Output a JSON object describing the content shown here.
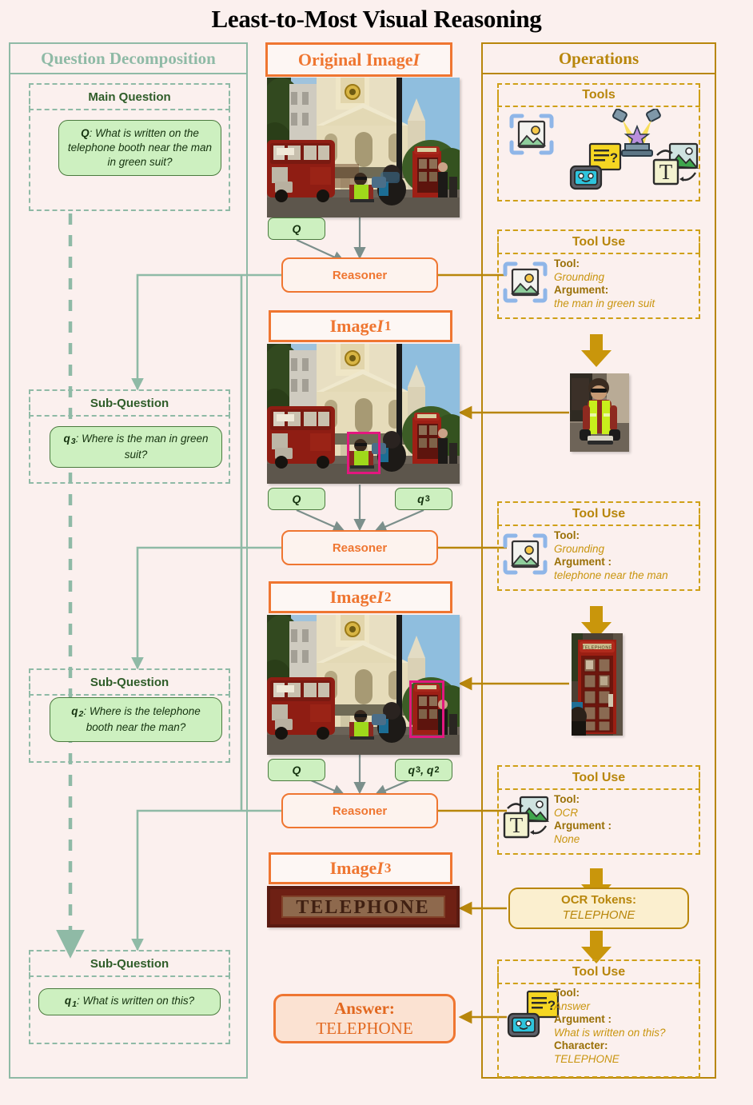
{
  "title": "Least-to-Most Visual Reasoning",
  "columns": {
    "decomposition": "Question Decomposition",
    "original": "Original Image ",
    "original_sym": "I",
    "operations": "Operations"
  },
  "decomposition": {
    "blocks": [
      {
        "heading": "Main Question",
        "tag": "Q",
        "sub": "",
        "text": "What is written on the telephone booth near the man in green suit?"
      },
      {
        "heading": "Sub-Question",
        "tag": "q",
        "sub": "3",
        "text": "Where is the man in green suit?"
      },
      {
        "heading": "Sub-Question",
        "tag": "q",
        "sub": "2",
        "text": "Where is the telephone booth near the man?"
      },
      {
        "heading": "Sub-Question",
        "tag": "q",
        "sub": "1",
        "text": "What is written on this?"
      }
    ]
  },
  "pipeline": {
    "reasoner_label": "Reasoner",
    "image_captions": [
      {
        "prefix": "Image ",
        "sym": "I",
        "sub": "1"
      },
      {
        "prefix": "Image ",
        "sym": "I",
        "sub": "2"
      },
      {
        "prefix": "Image ",
        "sym": "I",
        "sub": "3"
      }
    ],
    "tags": {
      "q_main": "Q",
      "q3": "q",
      "q3_sub": "3",
      "q32": "q",
      "q32_sub_a": "3",
      "q32_sub_b": "2",
      "q32_mid": ", q"
    },
    "ocr_image_text": "TELEPHONE",
    "answer": {
      "label": "Answer:",
      "value": "TELEPHONE"
    }
  },
  "operations": {
    "tools_heading": "Tools",
    "tool_icons": [
      "grounding-icon",
      "answer-robot-icon",
      "highlight-spotlight-icon",
      "ocr-icon"
    ],
    "tool_use_heading": "Tool Use",
    "tool_uses": [
      {
        "icon": "grounding-icon",
        "tool_label": "Tool:",
        "tool_value": "Grounding",
        "arg_label": "Argument:",
        "arg_value": "the man in green suit"
      },
      {
        "icon": "grounding-icon",
        "tool_label": "Tool:",
        "tool_value": "Grounding",
        "arg_label": "Argument :",
        "arg_value": "telephone near the man"
      },
      {
        "icon": "ocr-icon",
        "tool_label": "Tool:",
        "tool_value": "OCR",
        "arg_label": "Argument :",
        "arg_value": "None"
      },
      {
        "icon": "answer-robot-icon",
        "tool_label": "Tool:",
        "tool_value": "Answer",
        "arg_label": "Argument :",
        "arg_value": "What is written on this?",
        "char_label": "Character:",
        "char_value": "TELEPHONE"
      }
    ],
    "ocr_tokens": {
      "label": "OCR Tokens:",
      "value": "TELEPHONE"
    }
  },
  "colors": {
    "background": "#fbf0ee",
    "green": "#8fbaa6",
    "green_dark": "#2f5d29",
    "bubble_fill": "#cdf0c0",
    "orange": "#ef7631",
    "gold": "#b8860b",
    "gold_dash": "#cfa017",
    "bbox_pink": "#e3177f"
  }
}
